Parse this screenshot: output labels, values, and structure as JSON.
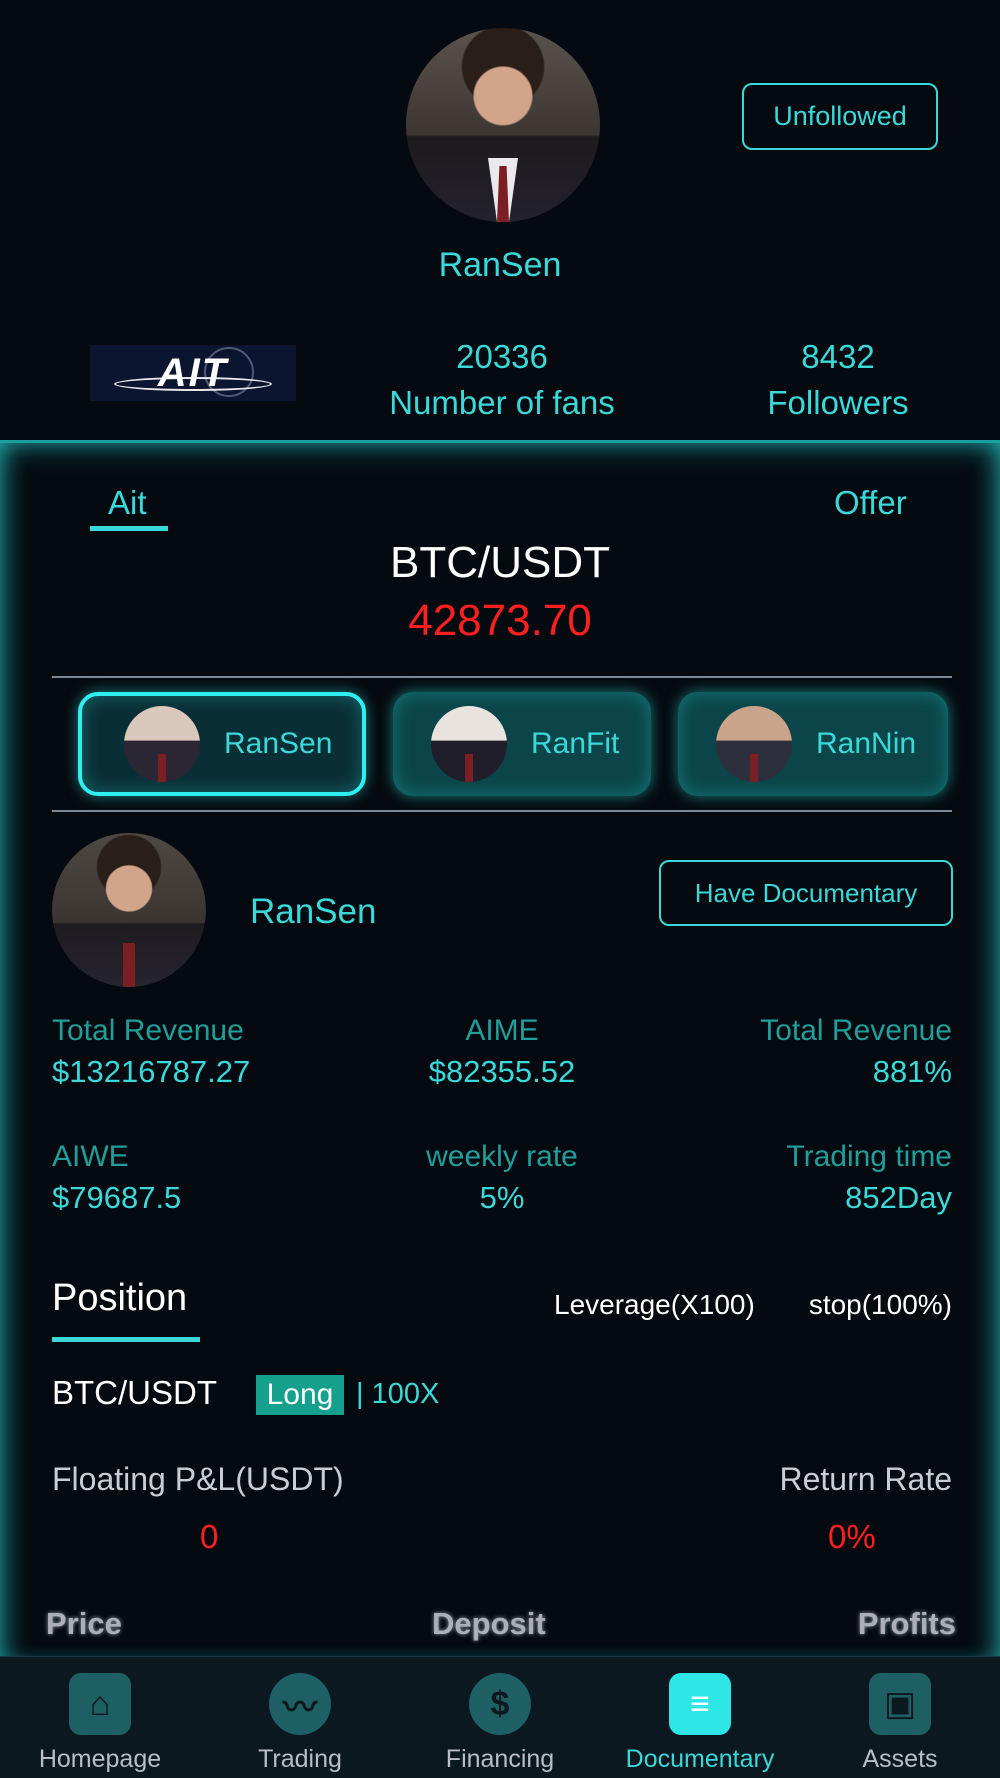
{
  "header": {
    "follow_button": "Unfollowed",
    "name": "RanSen",
    "logo_text": "AIT",
    "fans_count": "20336",
    "fans_label": "Number of fans",
    "followers_count": "8432",
    "followers_label": "Followers"
  },
  "tabs": {
    "left": "Ait",
    "right": "Offer"
  },
  "ticker": {
    "pair": "BTC/USDT",
    "price": "42873.70"
  },
  "traders": [
    {
      "name": "RanSen",
      "active": true
    },
    {
      "name": "RanFit",
      "active": false
    },
    {
      "name": "RanNin",
      "active": false
    }
  ],
  "detail": {
    "name": "RanSen",
    "doc_button": "Have Documentary",
    "stats": [
      {
        "label": "Total Revenue",
        "value": "$13216787.27"
      },
      {
        "label": "AIME",
        "value": "$82355.52"
      },
      {
        "label": "Total Revenue",
        "value": "881%"
      },
      {
        "label": "AIWE",
        "value": "$79687.5"
      },
      {
        "label": "weekly rate",
        "value": "5%"
      },
      {
        "label": "Trading time",
        "value": "852Day"
      }
    ]
  },
  "position": {
    "title": "Position",
    "leverage": "Leverage(X100)",
    "stop": "stop(100%)",
    "pair": "BTC/USDT",
    "side": "Long",
    "multiplier": "| 100X",
    "pl_label": "Floating P&L(USDT)",
    "pl_value": "0",
    "rate_label": "Return Rate",
    "rate_value": "0%",
    "columns": [
      "Price",
      "Deposit",
      "Profits"
    ]
  },
  "nav": [
    {
      "label": "Homepage",
      "icon": "home-icon"
    },
    {
      "label": "Trading",
      "icon": "trading-icon"
    },
    {
      "label": "Financing",
      "icon": "financing-icon"
    },
    {
      "label": "Documentary",
      "icon": "documentary-icon",
      "active": true
    },
    {
      "label": "Assets",
      "icon": "wallet-icon"
    }
  ],
  "colors": {
    "accent": "#39d9d9",
    "background": "#050a10",
    "price_red": "#ff1f1f",
    "long_badge": "#14a08c"
  }
}
